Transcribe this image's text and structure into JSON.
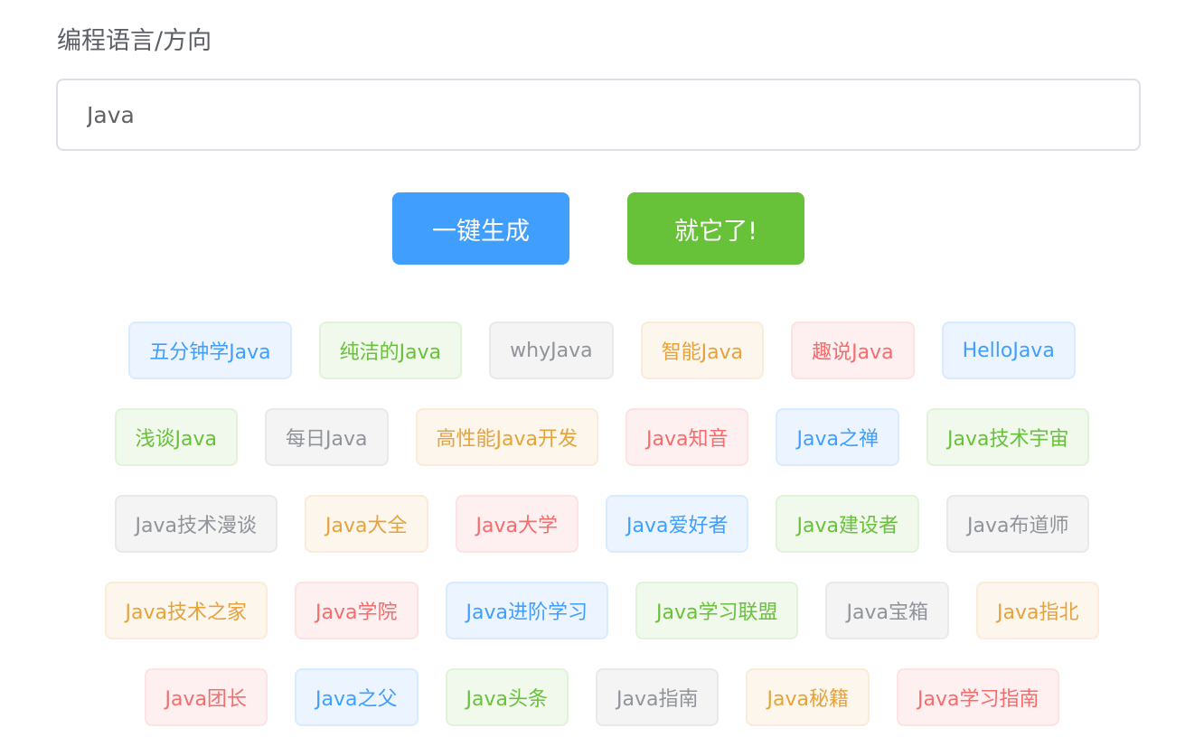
{
  "form": {
    "label": "编程语言/方向",
    "input_value": "Java"
  },
  "buttons": {
    "generate": "一键生成",
    "pick": "就它了!"
  },
  "tag_rows": [
    [
      {
        "text": "五分钟学Java",
        "color": "blue"
      },
      {
        "text": "纯洁的Java",
        "color": "green"
      },
      {
        "text": "whyJava",
        "color": "gray"
      },
      {
        "text": "智能Java",
        "color": "orange"
      },
      {
        "text": "趣说Java",
        "color": "red"
      },
      {
        "text": "HelloJava",
        "color": "blue"
      }
    ],
    [
      {
        "text": "浅谈Java",
        "color": "green"
      },
      {
        "text": "每日Java",
        "color": "gray"
      },
      {
        "text": "高性能Java开发",
        "color": "orange"
      },
      {
        "text": "Java知音",
        "color": "red"
      },
      {
        "text": "Java之禅",
        "color": "blue"
      },
      {
        "text": "Java技术宇宙",
        "color": "green"
      }
    ],
    [
      {
        "text": "Java技术漫谈",
        "color": "gray"
      },
      {
        "text": "Java大全",
        "color": "orange"
      },
      {
        "text": "Java大学",
        "color": "red"
      },
      {
        "text": "Java爱好者",
        "color": "blue"
      },
      {
        "text": "Java建设者",
        "color": "green"
      },
      {
        "text": "Java布道师",
        "color": "gray"
      }
    ],
    [
      {
        "text": "Java技术之家",
        "color": "orange"
      },
      {
        "text": "Java学院",
        "color": "red"
      },
      {
        "text": "Java进阶学习",
        "color": "blue"
      },
      {
        "text": "Java学习联盟",
        "color": "green"
      },
      {
        "text": "Java宝箱",
        "color": "gray"
      },
      {
        "text": "Java指北",
        "color": "orange"
      }
    ],
    [
      {
        "text": "Java团长",
        "color": "red"
      },
      {
        "text": "Java之父",
        "color": "blue"
      },
      {
        "text": "Java头条",
        "color": "green"
      },
      {
        "text": "Java指南",
        "color": "gray"
      },
      {
        "text": "Java秘籍",
        "color": "orange"
      },
      {
        "text": "Java学习指南",
        "color": "red"
      }
    ]
  ]
}
